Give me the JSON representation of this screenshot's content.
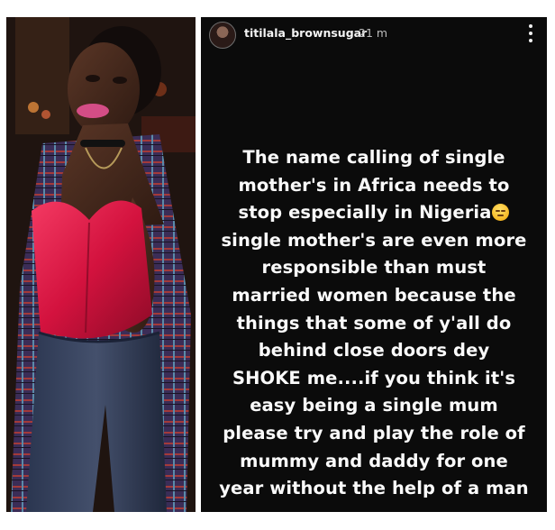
{
  "story": {
    "username": "titilala_brownsugar",
    "time": "21 m",
    "lines": [
      "The name calling of single",
      "mother's in Africa needs to",
      "stop especially in Nigeria",
      "single mother's are even more",
      "responsible than must",
      "married women because the",
      "things that some of y'all do",
      "behind close doors dey",
      "SHOKE me....if you think it's",
      "easy being a single mum",
      "please try and play the role of",
      "mummy and daddy for one",
      "year without the help of a man"
    ],
    "emoji": "unamused-face-icon",
    "more_icon": "more-vertical-icon"
  },
  "colors": {
    "story_background": "#0b0b0b",
    "text": "#fafafa",
    "top_color": "#e1194a",
    "shirt_color": "#3a2c58"
  }
}
